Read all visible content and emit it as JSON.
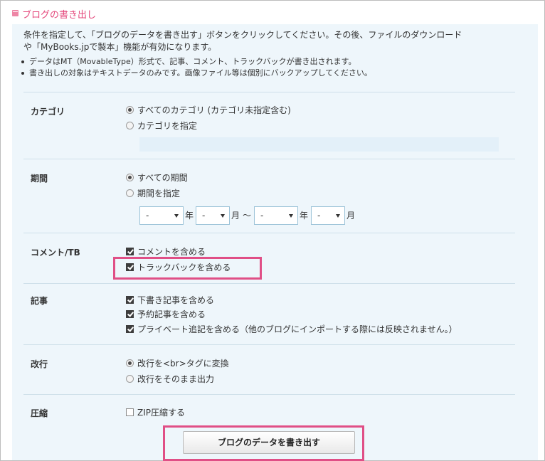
{
  "header": {
    "title": "ブログの書き出し"
  },
  "description": {
    "line1": "条件を指定して、「ブログのデータを書き出す」ボタンをクリックしてください。その後、ファイルのダウンロード",
    "line2": "や「MyBooks.jpで製本」機能が有効になります。"
  },
  "bullets": [
    "データはMT（MovableType）形式で、記事、コメント、トラックバックが書き出されます。",
    "書き出しの対象はテキストデータのみです。画像ファイル等は個別にバックアップしてください。"
  ],
  "category": {
    "label": "カテゴリ",
    "options": [
      {
        "label": "すべてのカテゴリ (カテゴリ未指定含む)",
        "checked": true
      },
      {
        "label": "カテゴリを指定",
        "checked": false
      }
    ],
    "input_value": ""
  },
  "period": {
    "label": "期間",
    "options": [
      {
        "label": "すべての期間",
        "checked": true
      },
      {
        "label": "期間を指定",
        "checked": false
      }
    ],
    "start_year": "-",
    "year_unit": "年",
    "start_month": "-",
    "month_unit": "月",
    "range_sep": "〜",
    "end_year": "-",
    "end_month": "-"
  },
  "comment_tb": {
    "label": "コメント/TB",
    "options": [
      {
        "label": "コメントを含める",
        "checked": true
      },
      {
        "label": "トラックバックを含める",
        "checked": true
      }
    ]
  },
  "articles": {
    "label": "記事",
    "options": [
      {
        "label": "下書き記事を含める",
        "checked": true
      },
      {
        "label": "予約記事を含める",
        "checked": true
      },
      {
        "label": "プライベート追記を含める（他のブログにインポートする際には反映されません。）",
        "checked": true
      }
    ]
  },
  "linebreak": {
    "label": "改行",
    "options": [
      {
        "label": "改行を<br>タグに変換",
        "checked": true
      },
      {
        "label": "改行をそのまま出力",
        "checked": false
      }
    ]
  },
  "compress": {
    "label": "圧縮",
    "options": [
      {
        "label": "ZIP圧縮する",
        "checked": false
      }
    ]
  },
  "export_button": "ブログのデータを書き出す",
  "colors": {
    "accent": "#e4477b",
    "highlight": "#e04f86",
    "panel": "#eef6fb"
  }
}
